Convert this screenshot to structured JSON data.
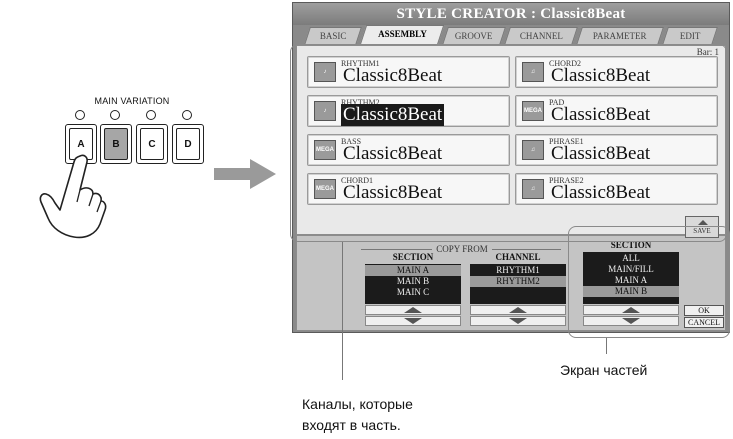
{
  "main_variation": {
    "title": "MAIN VARIATION",
    "buttons": [
      "A",
      "B",
      "C",
      "D"
    ],
    "active": "B"
  },
  "screen": {
    "title": "STYLE CREATOR : Classic8Beat",
    "tabs": [
      "BASIC",
      "ASSEMBLY",
      "GROOVE",
      "CHANNEL",
      "PARAMETER",
      "EDIT"
    ],
    "active_tab": "ASSEMBLY",
    "bar_label": "Bar:",
    "bar_value": "1",
    "channels": [
      {
        "name": "RHYTHM1",
        "value": "Classic8Beat",
        "icon": "drum-kit-icon",
        "selected": false
      },
      {
        "name": "CHORD2",
        "value": "Classic8Beat",
        "icon": "piano-icon",
        "selected": false
      },
      {
        "name": "RHYTHM2",
        "value": "Classic8Beat",
        "icon": "percussion-icon",
        "selected": true
      },
      {
        "name": "PAD",
        "value": "Classic8Beat",
        "icon": "mega-voice-icon",
        "selected": false
      },
      {
        "name": "BASS",
        "value": "Classic8Beat",
        "icon": "bass-guitar-icon",
        "selected": false
      },
      {
        "name": "PHRASE1",
        "value": "Classic8Beat",
        "icon": "piano-icon",
        "selected": false
      },
      {
        "name": "CHORD1",
        "value": "Classic8Beat",
        "icon": "guitar-icon",
        "selected": false
      },
      {
        "name": "PHRASE2",
        "value": "Classic8Beat",
        "icon": "piano-icon",
        "selected": false
      }
    ],
    "save_label": "SAVE",
    "copy_from_label": "COPY FROM",
    "source_section": {
      "header": "SECTION",
      "items": [
        "MAIN A",
        "MAIN B",
        "MAIN C"
      ],
      "highlighted": "MAIN A"
    },
    "source_channel": {
      "header": "CHANNEL",
      "items": [
        "RHYTHM1",
        "RHYTHM2"
      ],
      "highlighted": "RHYTHM2"
    },
    "target_section": {
      "header": "SECTION",
      "items": [
        "ALL",
        "MAIN/FILL",
        "MAIN A",
        "MAIN B"
      ],
      "highlighted": "MAIN B"
    },
    "ok_label": "OK",
    "cancel_label": "CANCEL"
  },
  "captions": {
    "parts_screen": "Экран частей",
    "channels_line1": "Каналы, которые",
    "channels_line2": "входят в часть."
  }
}
